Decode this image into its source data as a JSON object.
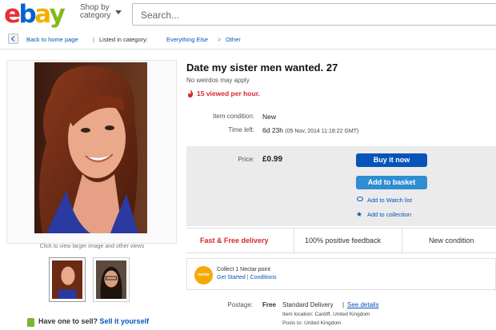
{
  "header": {
    "logo_letters": [
      {
        "ch": "e",
        "color": "#e53238"
      },
      {
        "ch": "b",
        "color": "#0064d2"
      },
      {
        "ch": "a",
        "color": "#f5af02"
      },
      {
        "ch": "y",
        "color": "#86b817"
      }
    ],
    "shop_by_line1": "Shop by",
    "shop_by_line2": "category",
    "search_placeholder": "Search..."
  },
  "breadcrumb": {
    "back": "Back to home page",
    "listed_in": "Listed in category:",
    "cat1": "Everything Else",
    "arrow": ">",
    "cat2": "Other",
    "bar": "|"
  },
  "gallery": {
    "hint": "Click to view larger image and other views"
  },
  "sell": {
    "question": "Have one to sell?",
    "link": "Sell it yourself"
  },
  "listing": {
    "title": "Date my sister men wanted. 27",
    "subtitle": "No weirdos may apply",
    "viewed": "15 viewed per hour.",
    "condition_label": "Item condition:",
    "condition_value": "New",
    "time_label": "Time left:",
    "time_value": "6d 23h",
    "time_detail": "(05 Nov, 2014  11:18:22 GMT)",
    "price_label": "Price:",
    "price_value": "£0.99"
  },
  "actions": {
    "buy": "Buy it now",
    "basket": "Add to basket",
    "watch": "Add to Watch list",
    "collection": "Add to collection"
  },
  "features": {
    "delivery": "Fast & Free delivery",
    "feedback": "100% positive feedback",
    "condition": "New condition"
  },
  "nectar": {
    "logo": "nectar",
    "line1": "Collect 1 Nectar point",
    "started": "Get Started",
    "sep": "|",
    "conditions": "Conditions"
  },
  "postage": {
    "label": "Postage:",
    "free": "Free",
    "standard": "Standard Delivery",
    "sep": "|",
    "see": "See details",
    "location": "Item location: Cardiff, United Kingdom",
    "posts": "Posts to: United Kingdom"
  },
  "colors": {
    "accent": "#0654ba",
    "alert": "#d9262b",
    "basket": "#2f8dd1"
  }
}
